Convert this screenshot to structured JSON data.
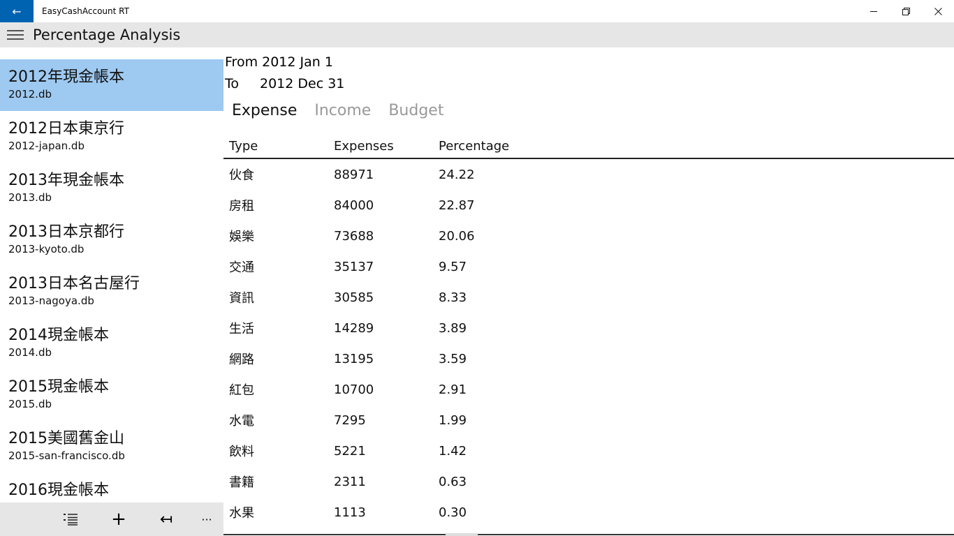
{
  "window": {
    "title": "EasyCashAccount RT",
    "back_glyph": "←",
    "minimize_glyph": "─",
    "maximize_glyph": "❐",
    "close_glyph": "✕"
  },
  "header": {
    "title": "Percentage Analysis"
  },
  "sidebar": {
    "items": [
      {
        "name": "2012年現金帳本",
        "file": "2012.db",
        "selected": true
      },
      {
        "name": "2012日本東京行",
        "file": "2012-japan.db"
      },
      {
        "name": "2013年現金帳本",
        "file": "2013.db"
      },
      {
        "name": "2013日本京都行",
        "file": "2013-kyoto.db"
      },
      {
        "name": "2013日本名古屋行",
        "file": "2013-nagoya.db"
      },
      {
        "name": "2014現金帳本",
        "file": "2014.db"
      },
      {
        "name": "2015現金帳本",
        "file": "2015.db"
      },
      {
        "name": "2015美國舊金山",
        "file": "2015-san-francisco.db"
      },
      {
        "name": "2016現金帳本",
        "file": ""
      }
    ],
    "toolbar": {
      "list_icon": "list-icon",
      "add_glyph": "+",
      "import_glyph": "↤",
      "more_glyph": "···"
    }
  },
  "main": {
    "from_text": "From 2012 Jan 1",
    "to_label": "To",
    "to_value": "2012 Dec 31",
    "tabs": [
      {
        "label": "Expense",
        "active": true
      },
      {
        "label": "Income"
      },
      {
        "label": "Budget"
      }
    ],
    "columns": [
      "Type",
      "Expenses",
      "Percentage"
    ],
    "rows": [
      [
        "伙食",
        "88971",
        "24.22"
      ],
      [
        "房租",
        "84000",
        "22.87"
      ],
      [
        "娛樂",
        "73688",
        "20.06"
      ],
      [
        "交通",
        "35137",
        "9.57"
      ],
      [
        "資訊",
        "30585",
        "8.33"
      ],
      [
        "生活",
        "14289",
        "3.89"
      ],
      [
        "網路",
        "13195",
        "3.59"
      ],
      [
        "紅包",
        "10700",
        "2.91"
      ],
      [
        "水電",
        "7295",
        "1.99"
      ],
      [
        "飲料",
        "5221",
        "1.42"
      ],
      [
        "書籍",
        "2311",
        "0.63"
      ],
      [
        "水果",
        "1113",
        "0.30"
      ]
    ]
  },
  "colors": {
    "accent": "#0063b1",
    "selected": "#9ec9f0",
    "header_bg": "#e6e6e6"
  }
}
